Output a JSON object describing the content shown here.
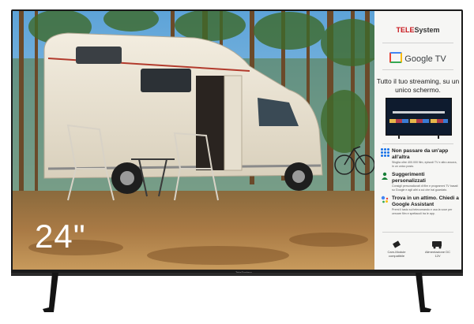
{
  "product": {
    "screen_size_label": "24\""
  },
  "brand": {
    "name_part1": "TELE",
    "name_part2": "System",
    "chin_logo": "TeleSystem"
  },
  "platform": {
    "name": "Google TV"
  },
  "panel": {
    "headline": "Tutto il tuo streaming, su un unico schermo.",
    "features": [
      {
        "icon": "apps-grid-icon",
        "title": "Non passare da un'app all'altra",
        "description": "Sfoglia oltre 400.000 film, episodi TV e altro ancora, in un unico posto."
      },
      {
        "icon": "person-icon",
        "title": "Suggerimenti personalizzati",
        "description": "Consigli personalizzati di film e programmi TV basati su Google e agli altri a cui che hai guardato."
      },
      {
        "icon": "google-assistant-icon",
        "title": "Trova in un attimo. Chiedi a Google Assistant",
        "description": "Premi il tasto sul telecomando e usa la voce per cercare film e spettacoli tra le app."
      }
    ],
    "bottom_icons": [
      {
        "icon": "cam-module-icon",
        "label": "Cam-Module compatibile"
      },
      {
        "icon": "camper-icon",
        "label": "Alimentazione DC 12V"
      }
    ]
  },
  "colors": {
    "brand_red": "#c8171d",
    "google_blue": "#4285f4",
    "frame": "#1a1a1a"
  }
}
